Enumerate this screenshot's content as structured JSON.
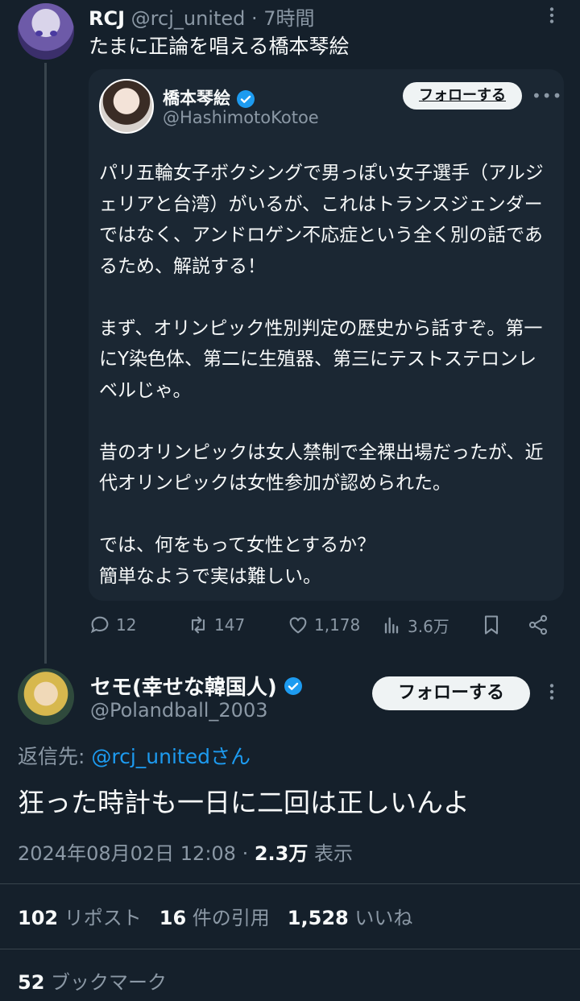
{
  "tweet": {
    "display_name": "RCJ",
    "handle": "@rcj_united",
    "time": "· 7時間",
    "text": "たまに正論を唱える橋本琴絵"
  },
  "quoted": {
    "display_name": "橋本琴絵",
    "handle": "@HashimotoKotoe",
    "follow_label": "フォローする",
    "more_label": "•••",
    "paragraphs": [
      "パリ五輪女子ボクシングで男っぽい女子選手（アルジェリアと台湾）がいるが、これはトランスジェンダーではなく、アンドロゲン不応症という全く別の話であるため、解説する！",
      "まず、オリンピック性別判定の歴史から話すぞ。第一にY染色体、第二に生殖器、第三にテストステロンレベルじゃ。",
      "昔のオリンピックは女人禁制で全裸出場だったが、近代オリンピックは女性参加が認められた。",
      "では、何をもって女性とするか？\n簡単なようで実は難しい。"
    ]
  },
  "actions": {
    "replies": "12",
    "retweets": "147",
    "likes": "1,178",
    "views": "3.6万"
  },
  "reply": {
    "display_name": "セモ(幸せな韓国人)",
    "handle": "@Polandball_2003",
    "follow_label": "フォローする",
    "reply_to_prefix": "返信先: ",
    "reply_to_handle": "@rcj_unitedさん",
    "text": "狂った時計も一日に二回は正しいんよ",
    "timestamp": "2024年08月02日 12:08 · ",
    "views_count": "2.3万",
    "views_label": " 表示",
    "stats": [
      {
        "count": "102",
        "label": " リポスト"
      },
      {
        "count": "16",
        "label": " 件の引用"
      },
      {
        "count": "1,528",
        "label": " いいね"
      }
    ],
    "bookmarks_count": "52",
    "bookmarks_label": " ブックマーク"
  },
  "colors": {
    "background": "#15202b",
    "card": "#1b2733",
    "muted": "#8b98a5",
    "accent": "#1d9bf0"
  }
}
